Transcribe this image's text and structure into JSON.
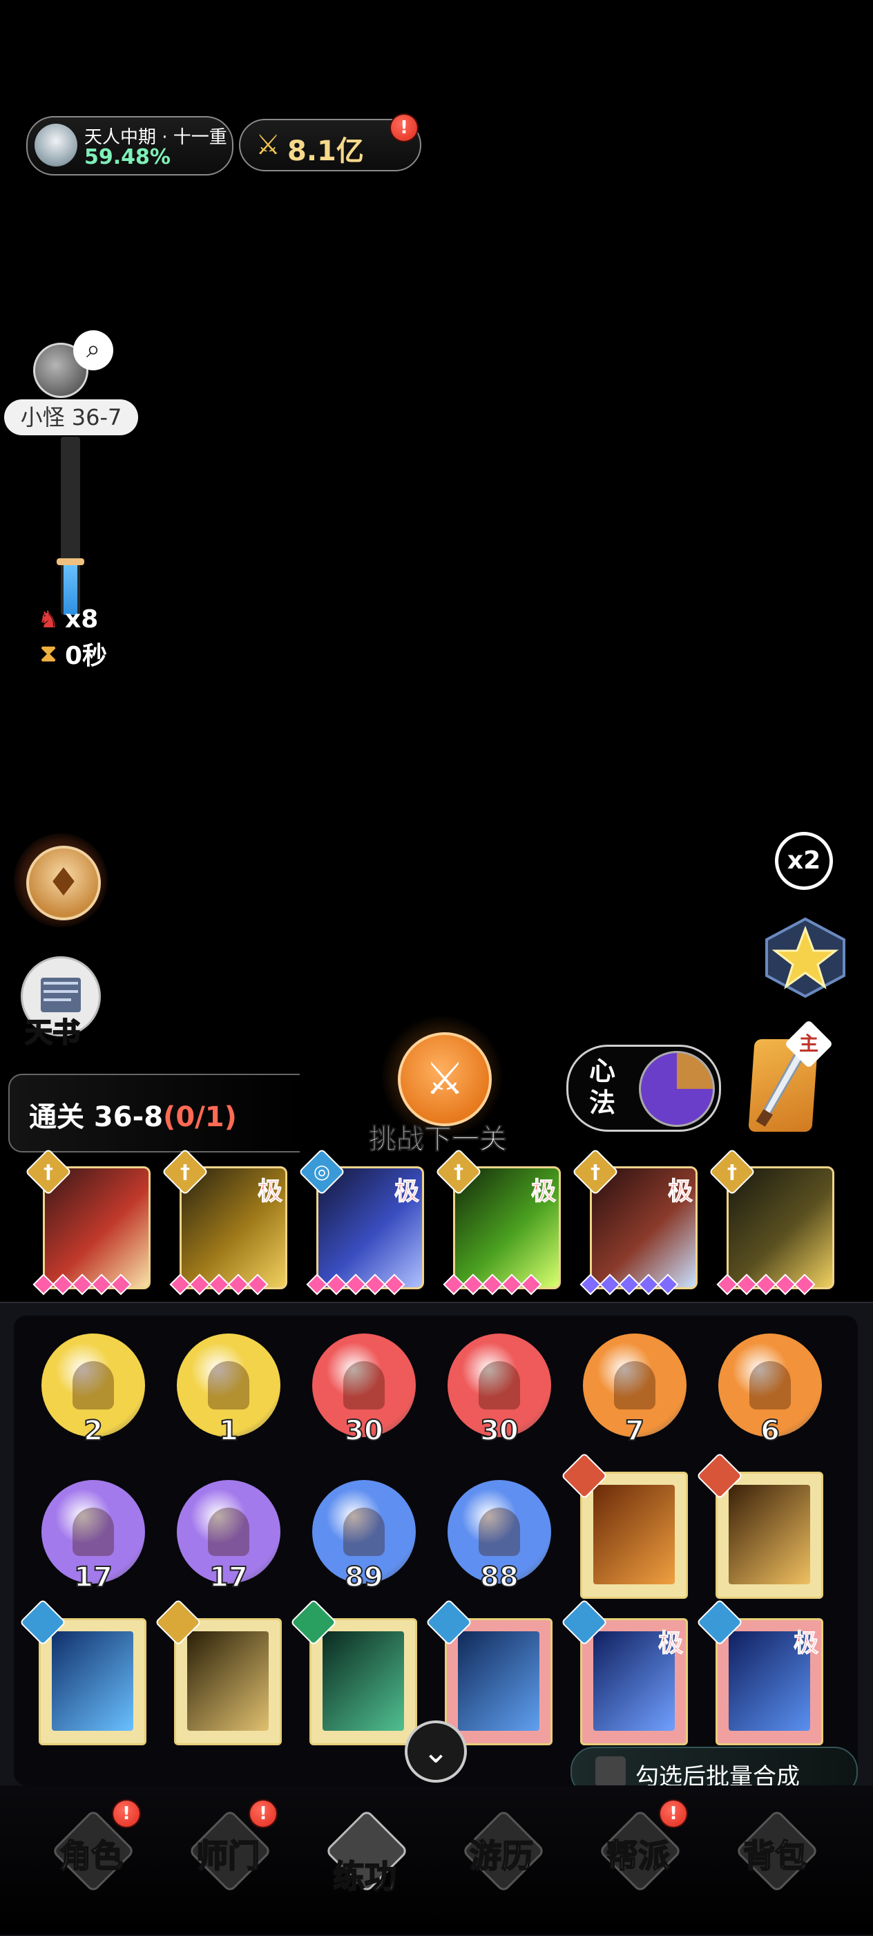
{
  "status": {
    "realm_name": "天人中期 · 十一重",
    "realm_progress": "59.48%",
    "power_value": "8.1亿",
    "power_alert": "!"
  },
  "stage": {
    "label": "小怪 36-7",
    "progress": 0.3,
    "monster_count": "x8",
    "timer": "0秒"
  },
  "side": {
    "tianshu_label": "天书",
    "speed_label": "x2"
  },
  "battle": {
    "clear_prefix": "通关 36-8",
    "clear_progress": "(0/1)",
    "challenge_label": "挑战下一关",
    "xinfa_label": "心法",
    "main_badge": "主"
  },
  "equipped_skills": [
    {
      "ji": "",
      "type": "sword",
      "gem_color": "#ff5fa8",
      "art": [
        "#3a1818",
        "#c0392b",
        "#f7e1a8"
      ]
    },
    {
      "ji": "极",
      "type": "sword",
      "gem_color": "#ff5fa8",
      "art": [
        "#2a2410",
        "#a07a1a",
        "#f0d060"
      ]
    },
    {
      "ji": "极",
      "type": "wind",
      "gem_color": "#ff5fa8",
      "art": [
        "#14183a",
        "#3a4ec0",
        "#b0c0ff"
      ]
    },
    {
      "ji": "极",
      "type": "sword",
      "gem_color": "#ff5fa8",
      "art": [
        "#142a0a",
        "#4aa020",
        "#d8ff70"
      ]
    },
    {
      "ji": "极",
      "type": "sword",
      "gem_color": "#7f6bff",
      "art": [
        "#2a1010",
        "#8a3a2a",
        "#c8e0ff"
      ]
    },
    {
      "ji": "",
      "type": "sword",
      "gem_color": "#ff5fa8",
      "art": [
        "#1a1a10",
        "#5a5020",
        "#f0d060"
      ]
    }
  ],
  "inventory": {
    "orbs": [
      {
        "count": "2",
        "color": "#f3d34a"
      },
      {
        "count": "1",
        "color": "#f3d34a"
      },
      {
        "count": "30",
        "color": "#ef5a5a"
      },
      {
        "count": "30",
        "color": "#ef5a5a"
      },
      {
        "count": "7",
        "color": "#f2923a"
      },
      {
        "count": "6",
        "color": "#f2923a"
      },
      {
        "count": "17",
        "color": "#a37aec"
      },
      {
        "count": "17",
        "color": "#a37aec"
      },
      {
        "count": "89",
        "color": "#5f8ff0"
      },
      {
        "count": "88",
        "color": "#5f8ff0"
      }
    ],
    "batch_label": "勾选后批量合成"
  },
  "nav": {
    "items": [
      {
        "label": "角色",
        "alert": "!"
      },
      {
        "label": "师门",
        "alert": "!"
      },
      {
        "label": "练功",
        "alert": ""
      },
      {
        "label": "游历",
        "alert": ""
      },
      {
        "label": "帮派",
        "alert": "!"
      },
      {
        "label": "背包",
        "alert": ""
      }
    ]
  }
}
